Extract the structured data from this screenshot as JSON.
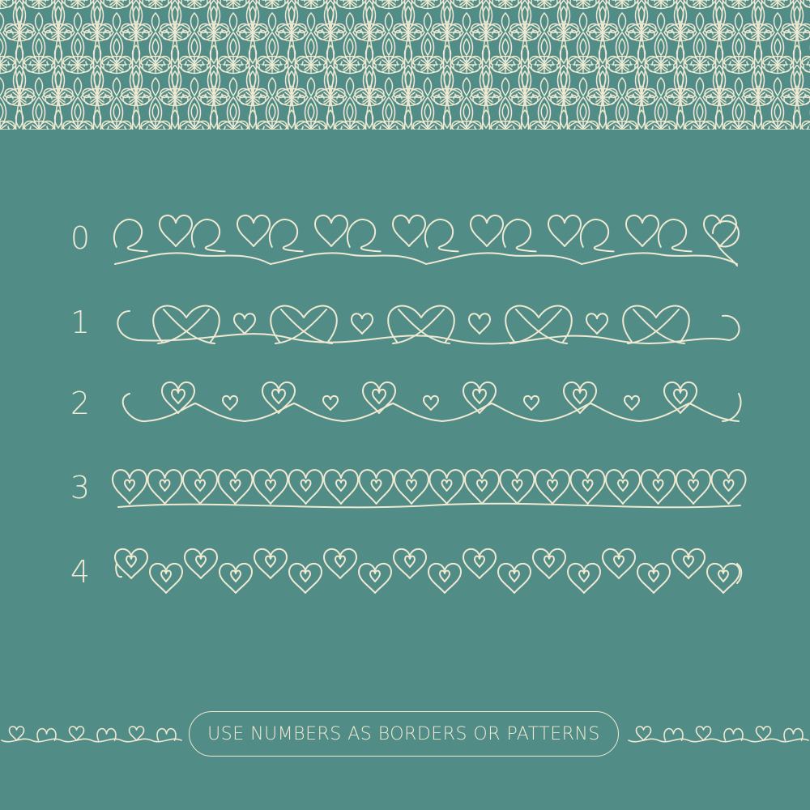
{
  "colors": {
    "background": "#528c87",
    "line": "#efe9d2"
  },
  "border_rows": [
    {
      "number": "0",
      "pattern": "loops-with-hearts"
    },
    {
      "number": "1",
      "pattern": "interlaced-hearts-with-small-hearts"
    },
    {
      "number": "2",
      "pattern": "nested-hearts-scallop"
    },
    {
      "number": "3",
      "pattern": "dense-heart-chain"
    },
    {
      "number": "4",
      "pattern": "double-heart-chain"
    }
  ],
  "caption": "USE NUMBERS AS BORDERS OR PATTERNS",
  "top_pattern": "ornamental-heart-lattice"
}
